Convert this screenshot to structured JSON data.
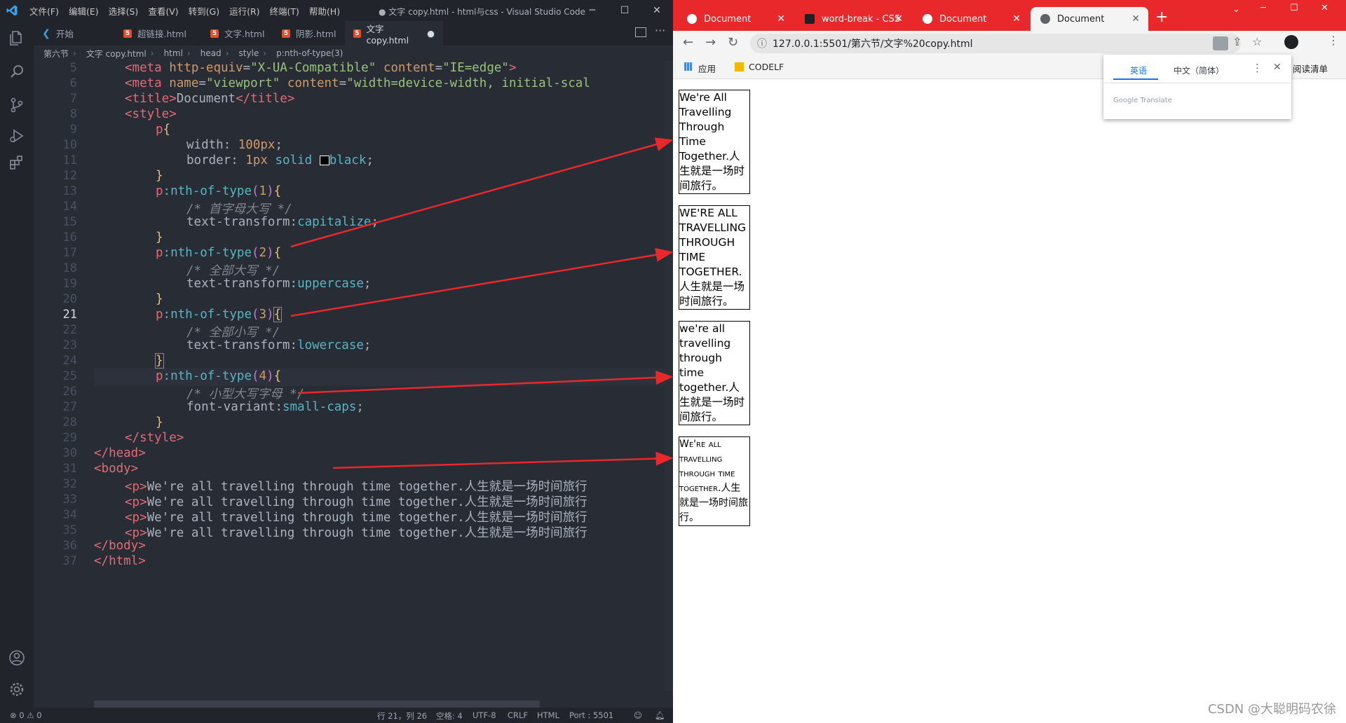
{
  "vscode": {
    "menus": [
      "文件(F)",
      "编辑(E)",
      "选择(S)",
      "查看(V)",
      "转到(G)",
      "运行(R)",
      "终端(T)",
      "帮助(H)"
    ],
    "title": "● 文字 copy.html - html与css - Visual Studio Code",
    "tabs": [
      {
        "label": "开始",
        "icon": "vscode-icon"
      },
      {
        "label": "超链接.html",
        "icon": "html5-icon"
      },
      {
        "label": "文字.html",
        "icon": "html5-icon"
      },
      {
        "label": "阴影.html",
        "icon": "html5-icon"
      },
      {
        "label": "文字 copy.html",
        "icon": "html5-icon",
        "modified": "●"
      }
    ],
    "breadcrumb": [
      "第六节",
      "文字 copy.html",
      "html",
      "head",
      "style",
      "p:nth-of-type(3)"
    ],
    "line_numbers": [
      "5",
      "6",
      "7",
      "8",
      "9",
      "10",
      "11",
      "12",
      "13",
      "14",
      "15",
      "16",
      "17",
      "18",
      "19",
      "20",
      "21",
      "22",
      "23",
      "24",
      "25",
      "26",
      "27",
      "28",
      "29",
      "30",
      "31",
      "32",
      "33",
      "34",
      "35",
      "36",
      "37"
    ],
    "code_text": {
      "l5_tag": "<meta",
      "l5_attr1": "http-equiv",
      "l5_val1": "\"X-UA-Compatible\"",
      "l5_attr2": "content",
      "l5_val2": "\"IE=edge\"",
      "l6_attr1": "name",
      "l6_val1": "\"viewport\"",
      "l6_val2": "\"width=device-width, initial-scal",
      "l7": "Document",
      "l13_sel": "p:nth-of-type",
      "l14": "/* 首字母大写 */",
      "l15_prop": "text-transform",
      "l15_val": "capitalize",
      "l18": "/* 全部大写 */",
      "l19_val": "uppercase",
      "l22": "/* 全部小写 */",
      "l23_val": "lowercase",
      "l26": "/* 小型大写字母 */",
      "l27_prop": "font-variant",
      "l27_val": "small-caps",
      "body_text": "We're all travelling through time together.人生就是一场时间旅行"
    },
    "status": {
      "errors": "⊗ 0 ⚠ 0",
      "position": "行 21，列 26",
      "spaces": "空格: 4",
      "encoding": "UTF-8",
      "eol": "CRLF",
      "language": "HTML",
      "port": "Port : 5501"
    }
  },
  "browser": {
    "tabs": [
      {
        "label": "Document"
      },
      {
        "label": "word-break - CSS"
      },
      {
        "label": "Document"
      },
      {
        "label": "Document",
        "active": true
      }
    ],
    "url": "127.0.0.1:5501/第六节/文字%20copy.html",
    "bookmarks": [
      "应用",
      "CODELF"
    ],
    "reading_list": "阅读清单",
    "translate": {
      "source_lang": "英语",
      "target_lang": "中文（简体）",
      "brand": "Google Translate"
    },
    "paragraphs": [
      "We're All Travelling Through Time Together.人生就是一场时间旅行。",
      "WE'RE ALL TRAVELLING THROUGH TIME TOGETHER.人生就是一场时间旅行。",
      "we're all travelling through time together.人生就是一场时间旅行。",
      "We're all travelling through time together.人生就是一场时间旅行。"
    ]
  },
  "watermark": "CSDN @大聪明码农徐"
}
